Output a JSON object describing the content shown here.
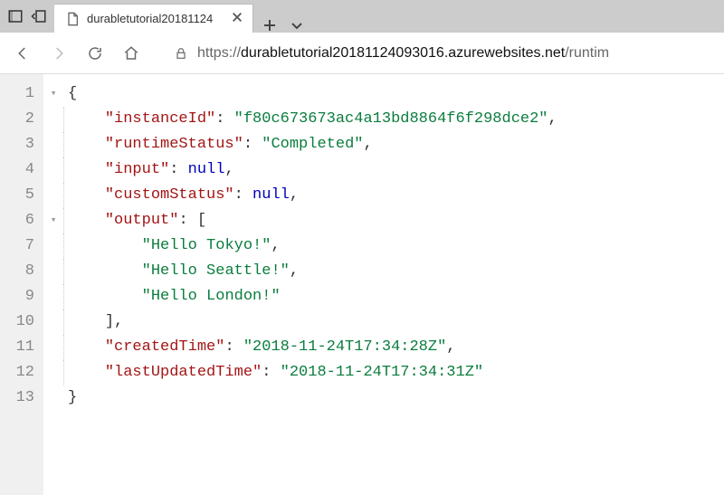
{
  "titlebar": {
    "icons": {
      "tabs_aside": "tabs-aside-icon",
      "set_aside": "set-aside-icon"
    }
  },
  "tab": {
    "title": "durabletutorial20181124",
    "close": "✕"
  },
  "tab_actions": {
    "new_tab": "＋",
    "dropdown": "⌄"
  },
  "toolbar": {
    "back": "←",
    "forward": "→",
    "refresh": "⟳",
    "home": "⌂"
  },
  "url": {
    "scheme": "https://",
    "host": "durabletutorial20181124093016.azurewebsites.net",
    "path": "/runtim"
  },
  "json_body": {
    "instanceId": "f80c673673ac4a13bd8864f6f298dce2",
    "runtimeStatus": "Completed",
    "input": null,
    "customStatus": null,
    "output": [
      "Hello Tokyo!",
      "Hello Seattle!",
      "Hello London!"
    ],
    "createdTime": "2018-11-24T17:34:28Z",
    "lastUpdatedTime": "2018-11-24T17:34:31Z"
  },
  "code_tokens": {
    "brace_open": "{",
    "brace_close": "}",
    "bracket_open": "[",
    "bracket_close": "],",
    "comma": ",",
    "null_lit": "null",
    "k_instanceId": "\"instanceId\"",
    "v_instanceId": "\"f80c673673ac4a13bd8864f6f298dce2\"",
    "k_runtimeStatus": "\"runtimeStatus\"",
    "v_runtimeStatus": "\"Completed\"",
    "k_input": "\"input\"",
    "k_customStatus": "\"customStatus\"",
    "k_output": "\"output\"",
    "v_out0": "\"Hello Tokyo!\"",
    "v_out1": "\"Hello Seattle!\"",
    "v_out2": "\"Hello London!\"",
    "k_createdTime": "\"createdTime\"",
    "v_createdTime": "\"2018-11-24T17:34:28Z\"",
    "k_lastUpdatedTime": "\"lastUpdatedTime\"",
    "v_lastUpdatedTime": "\"2018-11-24T17:34:31Z\""
  },
  "line_numbers": [
    "1",
    "2",
    "3",
    "4",
    "5",
    "6",
    "7",
    "8",
    "9",
    "10",
    "11",
    "12",
    "13"
  ],
  "fold_marks": {
    "l1": "▾",
    "l6": "▾"
  }
}
